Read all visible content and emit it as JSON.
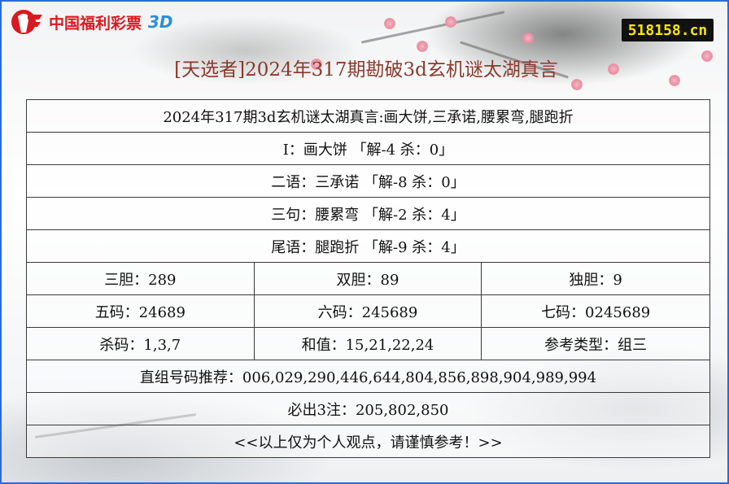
{
  "brand": {
    "logo_text": "中国福利彩票",
    "logo_suffix": "3D",
    "site_badge": "518158.cn",
    "accent": "#d9191f"
  },
  "page": {
    "title": "[天选者]2024年317期勘破3d玄机谜太湖真言"
  },
  "rows": {
    "summary": "2024年317期3d玄机谜太湖真言:画大饼,三承诺,腰累弯,腿跑折",
    "line1": "I：画大饼 「解-4 杀：0」",
    "line2": "二语：三承诺 「解-8 杀：0」",
    "line3": "三句：腰累弯 「解-2 杀：4」",
    "line4": "尾语：腿跑折 「解-9 杀：4」",
    "dan": [
      "三胆：289",
      "双胆：89",
      "独胆：9"
    ],
    "ma": [
      "五码：24689",
      "六码：245689",
      "七码：0245689"
    ],
    "misc": [
      "杀码：1,3,7",
      "和值：15,21,22,24",
      "参考类型：组三"
    ],
    "recommend": "直组号码推荐：006,029,290,446,644,804,856,898,904,989,994",
    "must": "必出3注：205,802,850",
    "disclaimer": "<<以上仅为个人观点，请谨慎参考！>>"
  }
}
